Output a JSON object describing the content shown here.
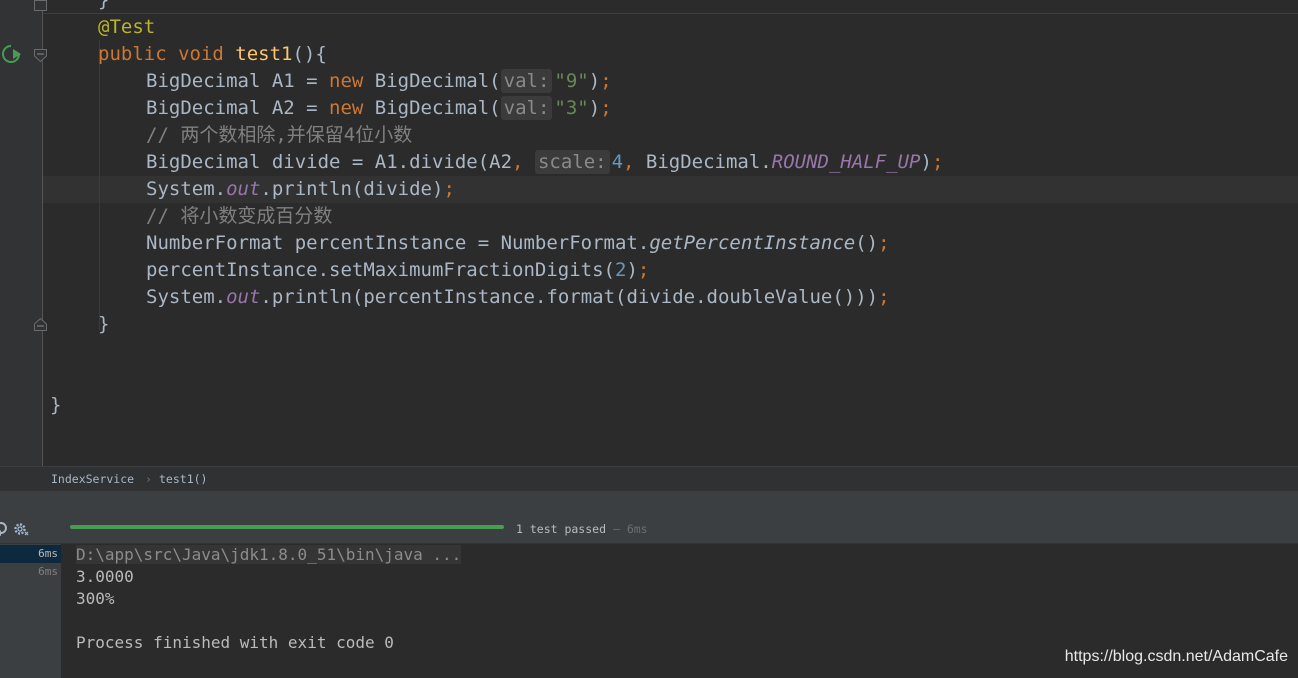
{
  "editor": {
    "lines": [
      [
        {
          "c": "",
          "t": "}"
        }
      ],
      [
        {
          "c": "ann",
          "t": "@Test"
        }
      ],
      [
        {
          "c": "kw",
          "t": "public void "
        },
        {
          "c": "fn",
          "t": "test1"
        },
        {
          "c": "",
          "t": "(){"
        }
      ],
      [
        {
          "c": "",
          "t": "BigDecimal A1 = "
        },
        {
          "c": "kw",
          "t": "new "
        },
        {
          "c": "",
          "t": "BigDecimal("
        },
        {
          "c": "hint",
          "t": "val:"
        },
        {
          "c": "str",
          "t": "\"9\""
        },
        {
          "c": "",
          "t": ")"
        },
        {
          "c": "semi",
          "t": ";"
        }
      ],
      [
        {
          "c": "",
          "t": "BigDecimal A2 = "
        },
        {
          "c": "kw",
          "t": "new "
        },
        {
          "c": "",
          "t": "BigDecimal("
        },
        {
          "c": "hint",
          "t": "val:"
        },
        {
          "c": "str",
          "t": "\"3\""
        },
        {
          "c": "",
          "t": ")"
        },
        {
          "c": "semi",
          "t": ";"
        }
      ],
      [
        {
          "c": "cmt",
          "t": "// 两个数相除,并保留4位小数"
        }
      ],
      [
        {
          "c": "",
          "t": "BigDecimal divide = A1.divide(A2"
        },
        {
          "c": "semi",
          "t": ", "
        },
        {
          "c": "hint",
          "t": "scale:"
        },
        {
          "c": "num",
          "t": "4"
        },
        {
          "c": "semi",
          "t": ", "
        },
        {
          "c": "",
          "t": "BigDecimal."
        },
        {
          "c": "stat",
          "t": "ROUND_HALF_UP"
        },
        {
          "c": "",
          "t": ")"
        },
        {
          "c": "semi",
          "t": ";"
        }
      ],
      [
        {
          "c": "",
          "t": "System."
        },
        {
          "c": "stat",
          "t": "out"
        },
        {
          "c": "",
          "t": ".println(divide)"
        },
        {
          "c": "semi",
          "t": ";"
        }
      ],
      [
        {
          "c": "cmt",
          "t": "// 将小数变成百分数"
        }
      ],
      [
        {
          "c": "",
          "t": "NumberFormat percentInstance = NumberFormat."
        },
        {
          "c": "ital",
          "t": "getPercentInstance"
        },
        {
          "c": "",
          "t": "()"
        },
        {
          "c": "semi",
          "t": ";"
        }
      ],
      [
        {
          "c": "",
          "t": "percentInstance.setMaximumFractionDigits("
        },
        {
          "c": "num",
          "t": "2"
        },
        {
          "c": "",
          "t": ")"
        },
        {
          "c": "semi",
          "t": ";"
        }
      ],
      [
        {
          "c": "",
          "t": "System."
        },
        {
          "c": "stat",
          "t": "out"
        },
        {
          "c": "",
          "t": ".println(percentInstance.format(divide.doubleValue()))"
        },
        {
          "c": "semi",
          "t": ";"
        }
      ],
      [
        {
          "c": "",
          "t": "}"
        }
      ],
      [],
      [],
      [
        {
          "c": "",
          "t": "}"
        }
      ]
    ]
  },
  "breadcrumb": {
    "class_name": "IndexService",
    "separator": "›",
    "method_name": "test1()"
  },
  "run": {
    "status_text": "1 test passed",
    "status_sep": "–",
    "status_time": "6ms",
    "tree": [
      "6ms",
      "6ms"
    ],
    "console": [
      "D:\\app\\src\\Java\\jdk1.8.0_51\\bin\\java ...",
      "3.0000",
      "300%",
      "",
      "Process finished with exit code 0"
    ]
  },
  "watermark": "https://blog.csdn.net/AdamCafe",
  "colors": {
    "background": "#2b2b2b",
    "keyword": "#cc7832",
    "annotation": "#bbb529",
    "method": "#ffc66d",
    "string": "#6a8759",
    "number": "#6897bb",
    "comment": "#808080",
    "static_field": "#9876aa",
    "progress_green": "#499c54"
  },
  "icons": [
    "run-test-icon",
    "fold-icon",
    "rerun-icon",
    "settings-gear-icon"
  ]
}
